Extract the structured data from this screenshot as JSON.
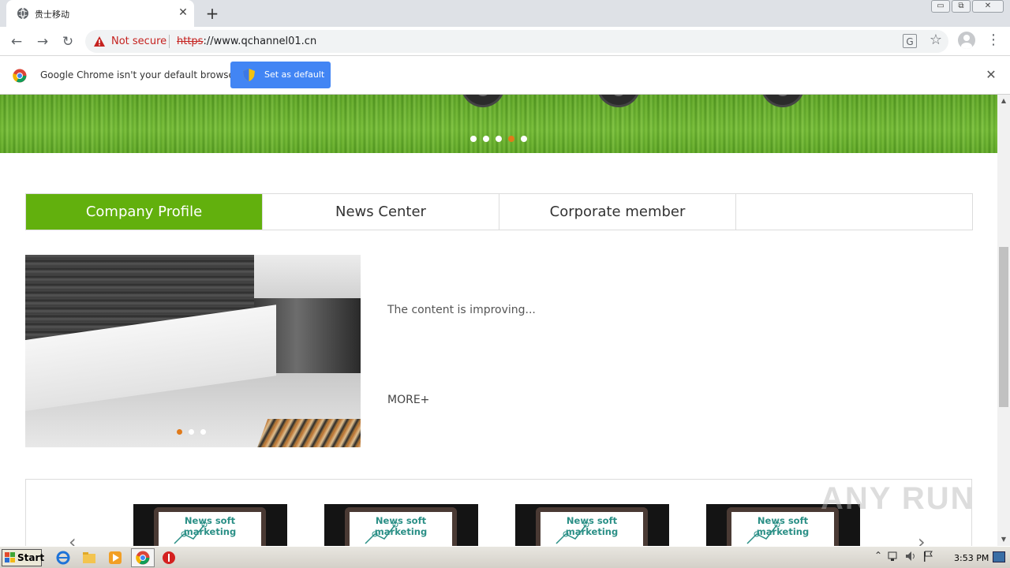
{
  "browser": {
    "tab_title": "贵士移动",
    "tab_close": "✕",
    "new_tab": "+",
    "security_label": "Not secure",
    "url_scheme": "https",
    "url_rest": "://www.qchannel01.cn",
    "window_controls": [
      "▭",
      "⧉",
      "✕"
    ],
    "nav": {
      "back": "←",
      "forward": "→",
      "reload": "↻"
    },
    "star": "☆",
    "menu": "⋮",
    "translate": "G"
  },
  "infobar": {
    "message": "Google Chrome isn't your default browser",
    "button_label": "Set as default",
    "close": "✕"
  },
  "page": {
    "banner_slide_count": 5,
    "banner_active_slide": 4,
    "tabs": [
      {
        "label": "Company Profile",
        "active": true
      },
      {
        "label": "News Center",
        "active": false
      },
      {
        "label": "Corporate member",
        "active": false
      }
    ],
    "photo_slide_count": 3,
    "photo_active_slide": 1,
    "content_text": "The content is improving...",
    "more_link": "MORE+",
    "news_cards": [
      {
        "caption": "News soft marketing"
      },
      {
        "caption": "News soft marketing"
      },
      {
        "caption": "News soft marketing"
      },
      {
        "caption": "News soft marketing"
      }
    ],
    "prev_arrow": "‹",
    "next_arrow": "›"
  },
  "scrollbar": {
    "up": "▲",
    "down": "▼"
  },
  "watermark": "ANY RUN",
  "taskbar": {
    "start_label": "Start",
    "clock": "3:53 PM",
    "tray_icons": [
      "⌃",
      "network",
      "volume",
      "flag"
    ]
  },
  "colors": {
    "accent_green": "#62b00d",
    "chrome_blue": "#4285f4",
    "not_secure_red": "#c5221f",
    "dot_active": "#e07a1a",
    "news_caption": "#2a8f86"
  }
}
